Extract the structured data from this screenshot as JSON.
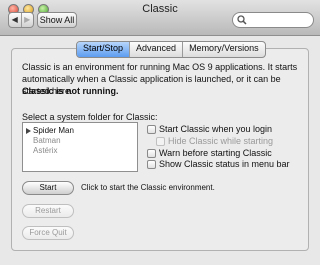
{
  "window": {
    "title": "Classic"
  },
  "toolbar": {
    "back_glyph": "◀",
    "forward_glyph": "▶",
    "show_all_label": "Show All",
    "search_placeholder": ""
  },
  "tabs": [
    {
      "label": "Start/Stop",
      "active": true
    },
    {
      "label": "Advanced",
      "active": false
    },
    {
      "label": "Memory/Versions",
      "active": false
    }
  ],
  "panel": {
    "description": "Classic is an environment for running Mac OS 9 applications. It starts automatically when a Classic application is launched, or it can be started here.",
    "status": "Classic is not running.",
    "select_label": "Select a system folder for Classic:",
    "folders": [
      {
        "name": "Spider Man",
        "enabled": true
      },
      {
        "name": "Batman",
        "enabled": false
      },
      {
        "name": "Astérix",
        "enabled": false
      }
    ],
    "options": {
      "start_on_login": "Start Classic when you login",
      "hide_while_starting": "Hide Classic while starting",
      "warn_before_starting": "Warn before starting Classic",
      "show_status_menubar": "Show Classic status in menu bar"
    },
    "buttons": {
      "start": "Start",
      "restart": "Restart",
      "force_quit": "Force Quit"
    },
    "start_hint": "Click to start the Classic environment."
  },
  "colors": {
    "active_tab": "#5c9cf0",
    "window_bg": "#e8e8e8"
  }
}
